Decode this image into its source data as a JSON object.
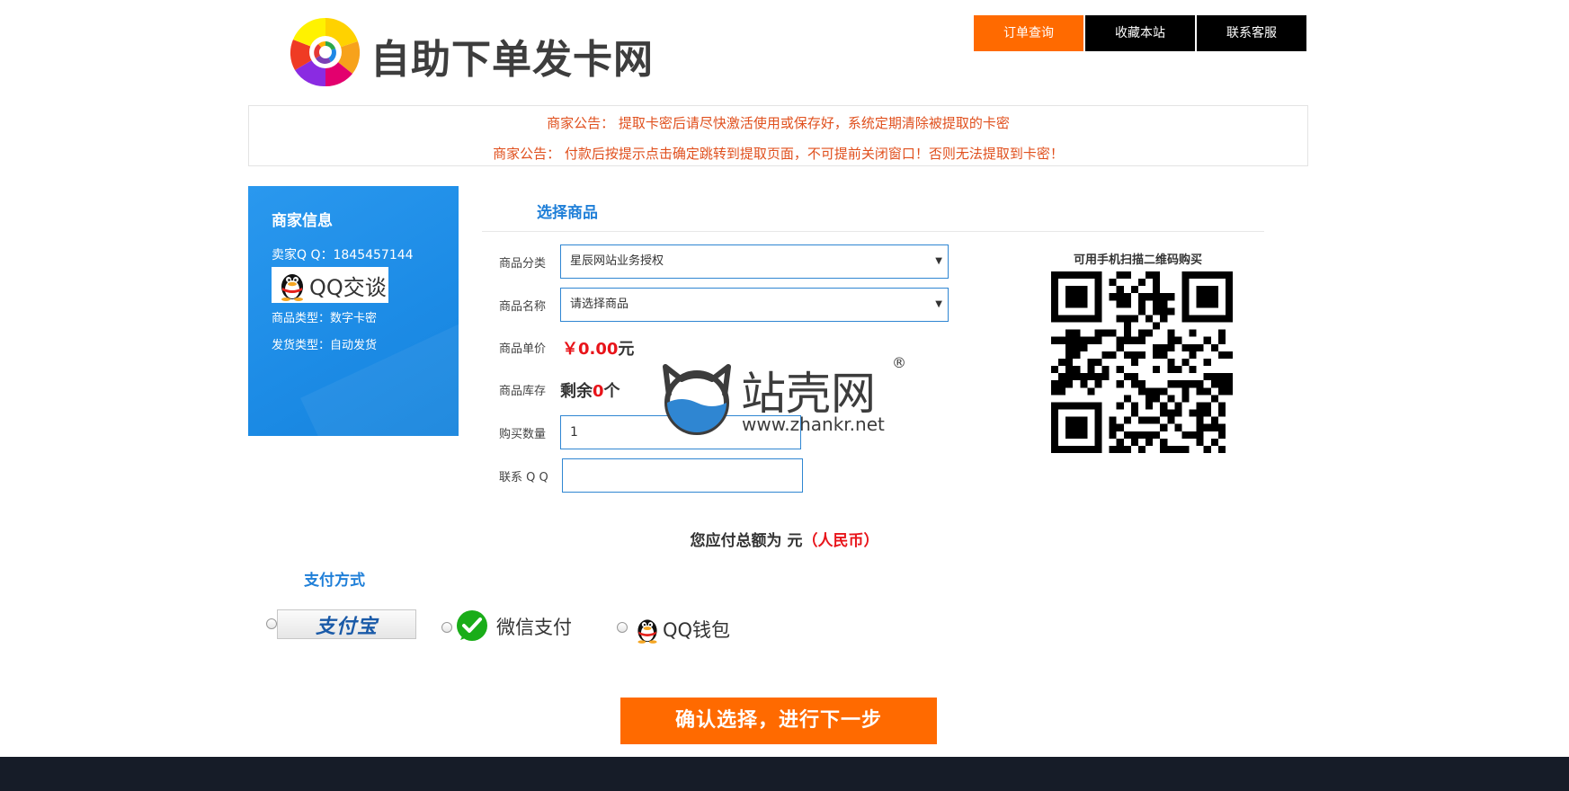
{
  "header": {
    "site_title": "自助下单发卡网",
    "nav": [
      {
        "label": "订单查询",
        "active": true
      },
      {
        "label": "收藏本站",
        "active": false
      },
      {
        "label": "联系客服",
        "active": false
      }
    ]
  },
  "notices": [
    "商家公告： 提取卡密后请尽快激活使用或保存好，系统定期清除被提取的卡密",
    "商家公告： 付款后按提示点击确定跳转到提取页面，不可提前关闭窗口！否则无法提取到卡密！"
  ],
  "merchant": {
    "title": "商家信息",
    "qq": "卖家Q Q：1845457144",
    "qq_chat_label": "QQ交谈",
    "product_type": "商品类型：数字卡密",
    "ship_type": "发货类型：自动发货"
  },
  "select": {
    "title": "选择商品",
    "category_label": "商品分类",
    "category_value": "星辰网站业务授权",
    "name_label": "商品名称",
    "name_value": "请选择商品",
    "price_label": "商品单价",
    "price_value": "￥0.00",
    "price_unit": "元",
    "stock_label": "商品库存",
    "stock_prefix": "剩余",
    "stock_value": "0",
    "stock_suffix": "个",
    "quantity_label": "购买数量",
    "quantity_value": "1",
    "contact_label": "联系 Q Q",
    "contact_value": ""
  },
  "watermark": {
    "text": "站壳网",
    "url": "www.zhankr.net",
    "reg": "®"
  },
  "qr": {
    "label": "可用手机扫描二维码购买"
  },
  "total": {
    "prefix": "您应付总额为 元",
    "suffix": "（人民币）"
  },
  "payment": {
    "title": "支付方式",
    "alipay_label": "支付宝",
    "wechat_label": "微信支付",
    "qqwallet_label": "QQ钱包"
  },
  "submit_label": "确认选择，进行下一步",
  "colors": {
    "accent_orange": "#ff6a00",
    "nav_black": "#000000",
    "merchant_blue": "#1d8ce6",
    "notice_red": "#e0501e",
    "price_red": "#e8141a",
    "section_blue": "#1f7fd8",
    "footer_dark": "#161c28"
  },
  "icons": [
    "logo-mark-icon",
    "qq-penguin-icon",
    "wechat-icon",
    "alipay-logo-icon",
    "qr-code-icon"
  ]
}
